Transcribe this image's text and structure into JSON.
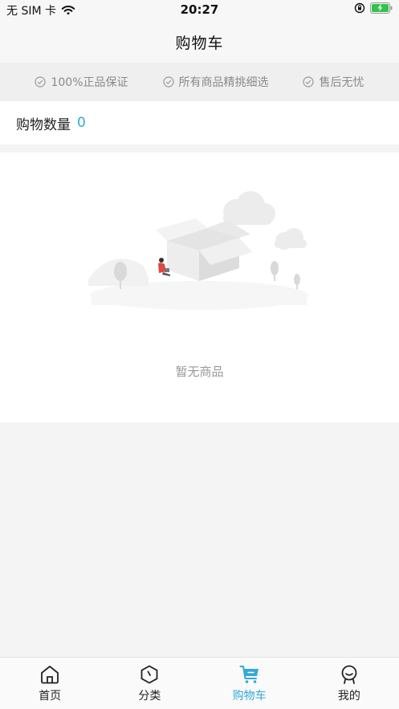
{
  "status_bar": {
    "carrier": "无 SIM 卡",
    "time": "20:27"
  },
  "nav": {
    "title": "购物车"
  },
  "guarantees": [
    {
      "label": "100%正品保证"
    },
    {
      "label": "所有商品精挑细选"
    },
    {
      "label": "售后无忧"
    }
  ],
  "cart": {
    "count_label": "购物数量",
    "count_value": "0"
  },
  "empty": {
    "message": "暂无商品"
  },
  "tabs": [
    {
      "label": "首页",
      "icon": "home-icon"
    },
    {
      "label": "分类",
      "icon": "category-icon"
    },
    {
      "label": "购物车",
      "icon": "cart-icon"
    },
    {
      "label": "我的",
      "icon": "profile-icon"
    }
  ],
  "colors": {
    "accent": "#33a9d6",
    "background": "#f4f4f4"
  }
}
